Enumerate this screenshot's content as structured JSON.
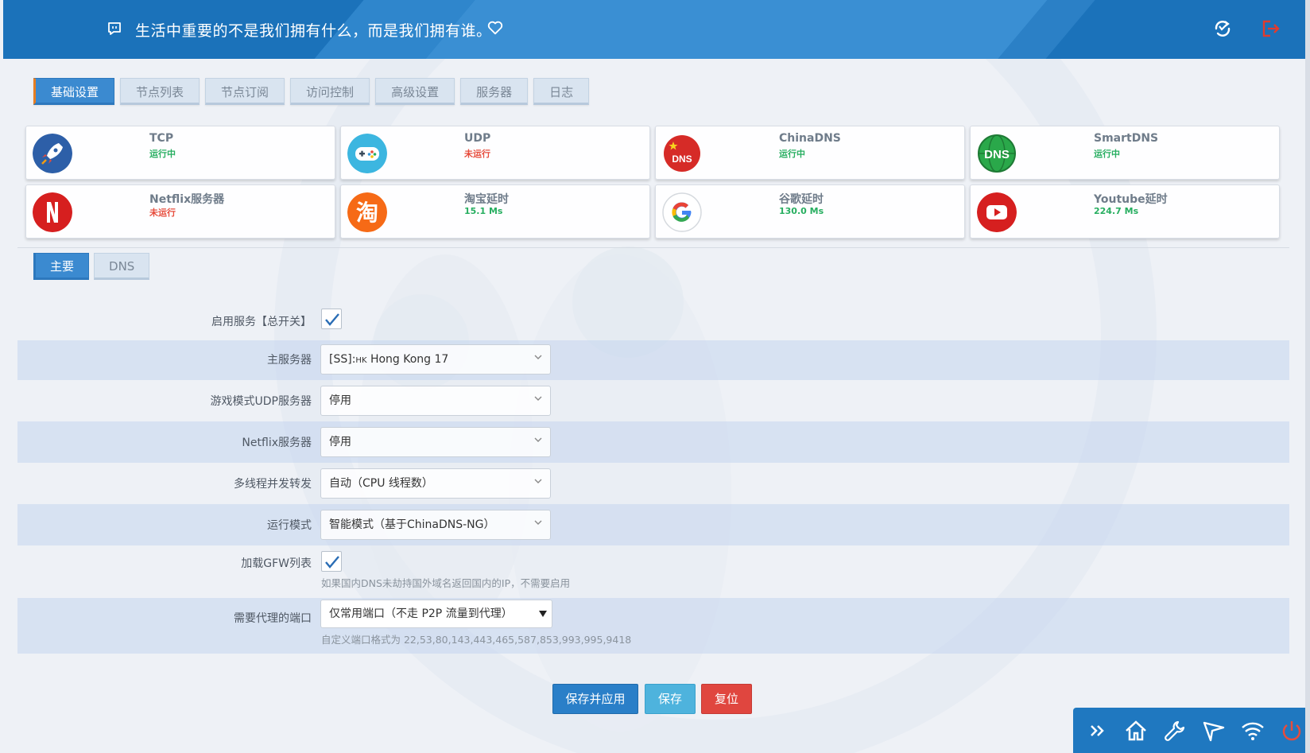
{
  "header": {
    "motto": "生活中重要的不是我们拥有什么，而是我们拥有谁。",
    "icons": [
      "message-icon",
      "heart-icon",
      "refresh-icon",
      "logout-icon"
    ]
  },
  "tabs": [
    {
      "label": "基础设置",
      "active": true
    },
    {
      "label": "节点列表",
      "active": false
    },
    {
      "label": "节点订阅",
      "active": false
    },
    {
      "label": "访问控制",
      "active": false
    },
    {
      "label": "高级设置",
      "active": false
    },
    {
      "label": "服务器",
      "active": false
    },
    {
      "label": "日志",
      "active": false
    }
  ],
  "cards": [
    {
      "title": "TCP",
      "status": "运行中",
      "state": "ok",
      "icon": "rocket-icon"
    },
    {
      "title": "UDP",
      "status": "未运行",
      "state": "bad",
      "icon": "gamepad-icon"
    },
    {
      "title": "ChinaDNS",
      "status": "运行中",
      "state": "ok",
      "icon": "china-dns-icon"
    },
    {
      "title": "SmartDNS",
      "status": "运行中",
      "state": "ok",
      "icon": "smart-dns-icon"
    },
    {
      "title": "Netflix服务器",
      "status": "未运行",
      "state": "bad",
      "icon": "netflix-icon"
    },
    {
      "title": "淘宝延时",
      "status": "15.1 Ms",
      "state": "ok",
      "icon": "taobao-icon"
    },
    {
      "title": "谷歌延时",
      "status": "130.0 Ms",
      "state": "ok",
      "icon": "google-icon"
    },
    {
      "title": "Youtube延时",
      "status": "224.7 Ms",
      "state": "ok",
      "icon": "youtube-icon"
    }
  ],
  "subtabs": [
    {
      "label": "主要",
      "active": true
    },
    {
      "label": "DNS",
      "active": false
    }
  ],
  "form": {
    "enable": {
      "label": "启用服务【总开关】",
      "checked": true
    },
    "main_server": {
      "label": "主服务器",
      "value_prefix": "[SS]:",
      "value_flag": "HK",
      "value": "Hong Kong 17"
    },
    "udp_server": {
      "label": "游戏模式UDP服务器",
      "value": "停用"
    },
    "netflix_server": {
      "label": "Netflix服务器",
      "value": "停用"
    },
    "threads": {
      "label": "多线程并发转发",
      "value": "自动（CPU 线程数）"
    },
    "run_mode": {
      "label": "运行模式",
      "value": "智能模式（基于ChinaDNS-NG）"
    },
    "gfw": {
      "label": "加载GFW列表",
      "checked": true,
      "hint": "如果国内DNS未劫持国外域名返回国内的IP，不需要启用"
    },
    "ports": {
      "label": "需要代理的端口",
      "value": "仅常用端口（不走 P2P 流量到代理）",
      "hint": "自定义端口格式为 22,53,80,143,443,465,587,853,993,995,9418"
    }
  },
  "buttons": {
    "save_apply": "保存并应用",
    "save": "保存",
    "reset": "复位"
  },
  "dock": [
    "chevrons-right-icon",
    "home-icon",
    "wrench-icon",
    "send-icon",
    "wifi-icon",
    "power-icon"
  ],
  "colors": {
    "header": "#1b72ba",
    "accent": "#3b8ad0",
    "ok": "#27ae60",
    "bad": "#e74c3c",
    "danger_button": "#e0463f",
    "info_button": "#4eb3dd"
  }
}
